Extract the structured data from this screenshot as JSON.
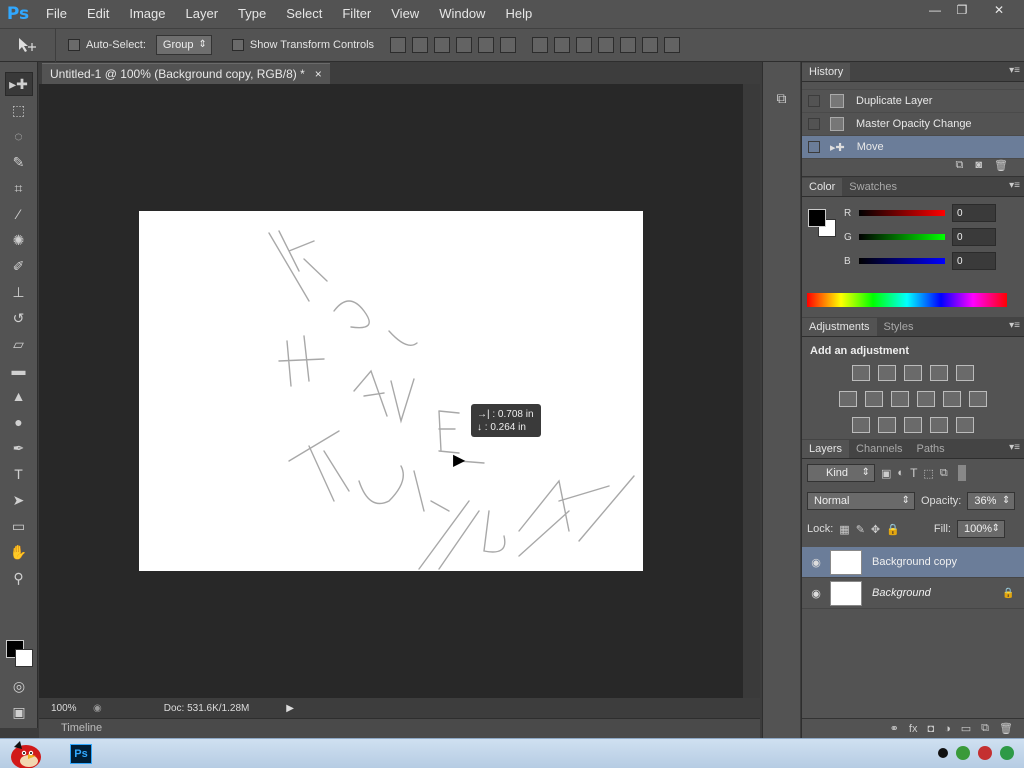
{
  "app": {
    "logo": "Ps"
  },
  "menu": [
    "File",
    "Edit",
    "Image",
    "Layer",
    "Type",
    "Select",
    "Filter",
    "View",
    "Window",
    "Help"
  ],
  "window_controls": {
    "min": "—",
    "max": "❐",
    "close": "✕"
  },
  "options_bar": {
    "auto_select_label": "Auto-Select:",
    "auto_select_value": "Group",
    "transform_label": "Show Transform Controls"
  },
  "document": {
    "tab_title": "Untitled-1 @ 100% (Background copy, RGB/8) *",
    "tab_close": "×",
    "tooltip_line1": "→| :  0.708 in",
    "tooltip_line2": "↓ :  0.264 in",
    "zoom": "100%",
    "doc_info": "Doc: 531.6K/1.28M",
    "timeline_label": "Timeline"
  },
  "history": {
    "tab": "History",
    "items": [
      {
        "label": "Duplicate Layer",
        "selected": false
      },
      {
        "label": "Master Opacity Change",
        "selected": false
      },
      {
        "label": "Move",
        "selected": true
      }
    ]
  },
  "color": {
    "tabs": [
      "Color",
      "Swatches"
    ],
    "channels": [
      {
        "label": "R",
        "value": "0",
        "gradient": "linear-gradient(90deg,#000,#f00)"
      },
      {
        "label": "G",
        "value": "0",
        "gradient": "linear-gradient(90deg,#000,#0f0)"
      },
      {
        "label": "B",
        "value": "0",
        "gradient": "linear-gradient(90deg,#000,#00f)"
      }
    ]
  },
  "adjustments": {
    "tabs": [
      "Adjustments",
      "Styles"
    ],
    "title": "Add an adjustment"
  },
  "layers": {
    "tabs": [
      "Layers",
      "Channels",
      "Paths"
    ],
    "filter_kind": "Kind",
    "blend_mode": "Normal",
    "opacity_label": "Opacity:",
    "opacity_value": "36%",
    "lock_label": "Lock:",
    "fill_label": "Fill:",
    "fill_value": "100%",
    "items": [
      {
        "name": "Background copy",
        "selected": true,
        "locked": false
      },
      {
        "name": "Background",
        "selected": false,
        "locked": true
      }
    ]
  },
  "colors": {
    "accent_selection": "#6b7d99",
    "ps_blue": "#31a8ff"
  }
}
